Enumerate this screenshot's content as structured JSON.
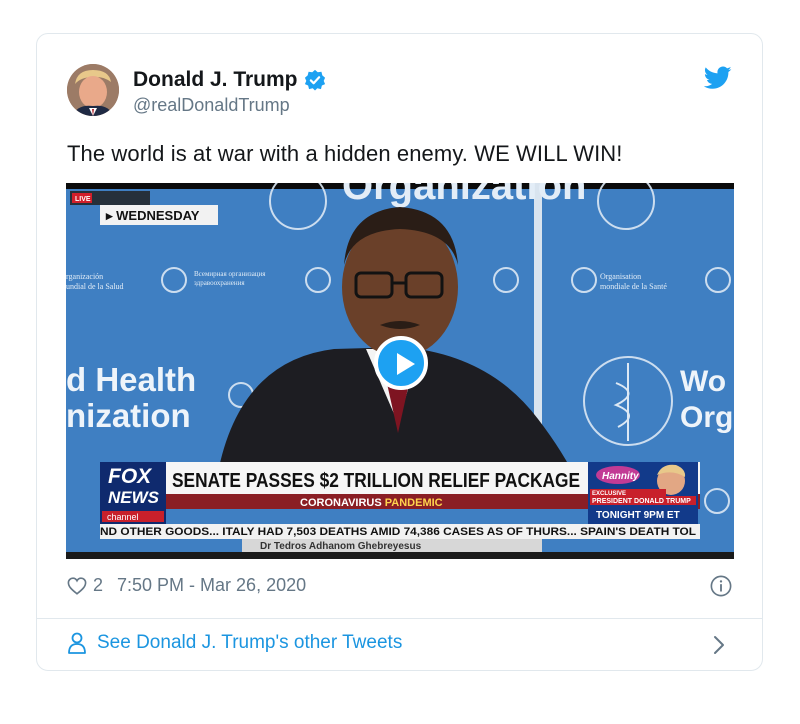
{
  "tweet": {
    "author_name": "Donald J. Trump",
    "handle": "@realDonaldTrump",
    "text": "The world is at war with a hidden enemy. WE WILL WIN!",
    "likes": "2",
    "timestamp": "7:50 PM - Mar 26, 2020"
  },
  "footer": {
    "link_label": "See Donald J. Trump's other Tweets"
  },
  "video": {
    "live_tag": "LIVE",
    "day_label": "▸ WEDNESDAY",
    "backdrop_top": "Organization",
    "backdrop_left_line1": "d Health",
    "backdrop_left_line2": "nization",
    "backdrop_right_line1": "Wo",
    "backdrop_right_line2": "Org",
    "small_left_line1": "rganización",
    "small_left_line2": "undial de la Salud",
    "small_mid_line1": "Всемирная организация",
    "small_mid_line2": "здравоохранения",
    "small_right_line1": "Organisation",
    "small_right_line2": "mondiale de la Santé",
    "network_line1": "FOX",
    "network_line2": "NEWS",
    "network_line3": "channel",
    "headline": "SENATE PASSES $2 TRILLION RELIEF PACKAGE",
    "subhead_prefix": "CORONAVIRUS ",
    "subhead_emphasis": "PANDEMIC",
    "promo_show": "Hannity",
    "promo_line1": "EXCLUSIVE",
    "promo_line2": "PRESIDENT DONALD TRUMP",
    "promo_line3": "TONIGHT 9PM ET",
    "ticker": "ND OTHER GOODS...  ITALY HAD 7,503 DEATHS AMID 74,386 CASES AS OF THURS...  SPAIN'S DEATH TOL",
    "speaker_name": "Dr Tedros Adhanom Ghebreyesus"
  },
  "colors": {
    "twitter_blue": "#1da1f2",
    "link_blue": "#1b95e0",
    "secondary_text": "#657786",
    "fox_red": "#c8202b",
    "fox_blue": "#0f2a6e"
  }
}
